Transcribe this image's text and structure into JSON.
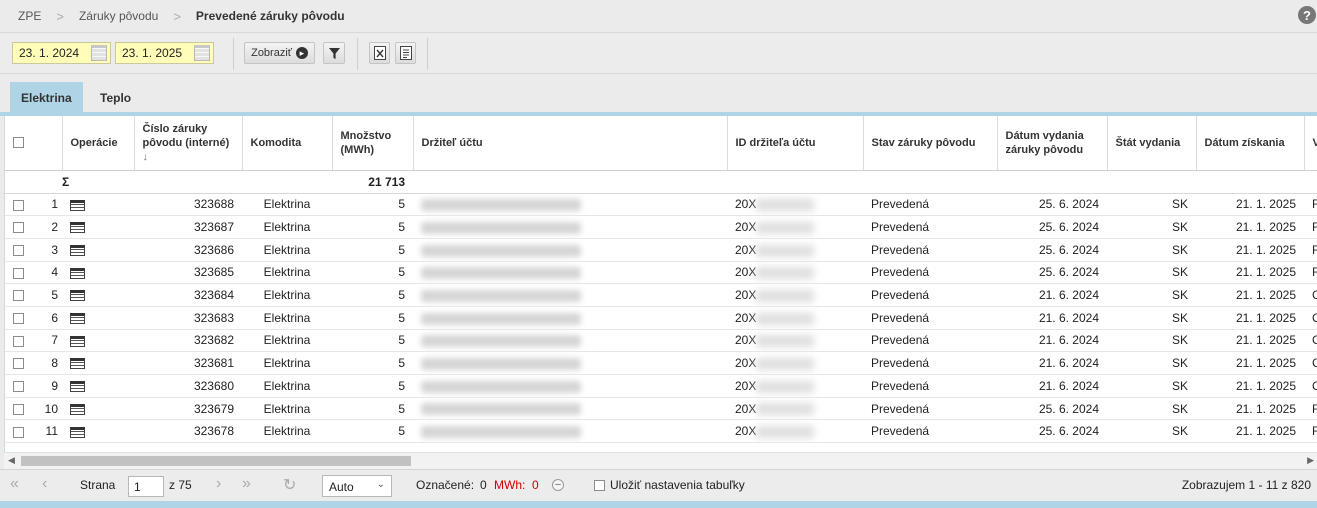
{
  "breadcrumb": {
    "items": [
      "ZPE",
      "Záruky pôvodu"
    ],
    "current": "Prevedené záruky pôvodu",
    "separator": ">"
  },
  "help_icon": "?",
  "toolbar": {
    "date_from": "23. 1. 2024",
    "date_to": "23. 1. 2025",
    "show_label": "Zobraziť",
    "icons": [
      "calendar-icon",
      "filter-icon",
      "excel-export-icon",
      "document-export-icon"
    ]
  },
  "tabs": [
    {
      "label": "Elektrina",
      "active": true
    },
    {
      "label": "Teplo",
      "active": false
    }
  ],
  "columns": {
    "operations": "Operácie",
    "number": "Číslo záruky pôvodu (interné)",
    "sort_arrow": "↓",
    "commodity": "Komodita",
    "amount": "Množstvo (MWh)",
    "holder": "Držiteľ účtu",
    "holder_id": "ID držiteľa účtu",
    "status": "Stav záruky pôvodu",
    "issue_date": "Dátum vydania záruky pôvodu",
    "country": "Štát vydania",
    "acquired_date": "Dátum získania",
    "next_partial": "V"
  },
  "summary": {
    "sigma": "Σ",
    "amount_total": "21 713"
  },
  "rows": [
    {
      "n": "1",
      "number": "323688",
      "commodity": "Elektrina",
      "amount": "5",
      "holder_id_prefix": "20X",
      "status": "Prevedená",
      "issue_date": "25. 6. 2024",
      "country": "SK",
      "acquired_date": "21. 1. 2025",
      "last": "F"
    },
    {
      "n": "2",
      "number": "323687",
      "commodity": "Elektrina",
      "amount": "5",
      "holder_id_prefix": "20X",
      "status": "Prevedená",
      "issue_date": "25. 6. 2024",
      "country": "SK",
      "acquired_date": "21. 1. 2025",
      "last": "F"
    },
    {
      "n": "3",
      "number": "323686",
      "commodity": "Elektrina",
      "amount": "5",
      "holder_id_prefix": "20X",
      "status": "Prevedená",
      "issue_date": "25. 6. 2024",
      "country": "SK",
      "acquired_date": "21. 1. 2025",
      "last": "F"
    },
    {
      "n": "4",
      "number": "323685",
      "commodity": "Elektrina",
      "amount": "5",
      "holder_id_prefix": "20X",
      "status": "Prevedená",
      "issue_date": "25. 6. 2024",
      "country": "SK",
      "acquired_date": "21. 1. 2025",
      "last": "F"
    },
    {
      "n": "5",
      "number": "323684",
      "commodity": "Elektrina",
      "amount": "5",
      "holder_id_prefix": "20X",
      "status": "Prevedená",
      "issue_date": "21. 6. 2024",
      "country": "SK",
      "acquired_date": "21. 1. 2025",
      "last": "C"
    },
    {
      "n": "6",
      "number": "323683",
      "commodity": "Elektrina",
      "amount": "5",
      "holder_id_prefix": "20X",
      "status": "Prevedená",
      "issue_date": "21. 6. 2024",
      "country": "SK",
      "acquired_date": "21. 1. 2025",
      "last": "C"
    },
    {
      "n": "7",
      "number": "323682",
      "commodity": "Elektrina",
      "amount": "5",
      "holder_id_prefix": "20X",
      "status": "Prevedená",
      "issue_date": "21. 6. 2024",
      "country": "SK",
      "acquired_date": "21. 1. 2025",
      "last": "C"
    },
    {
      "n": "8",
      "number": "323681",
      "commodity": "Elektrina",
      "amount": "5",
      "holder_id_prefix": "20X",
      "status": "Prevedená",
      "issue_date": "21. 6. 2024",
      "country": "SK",
      "acquired_date": "21. 1. 2025",
      "last": "C"
    },
    {
      "n": "9",
      "number": "323680",
      "commodity": "Elektrina",
      "amount": "5",
      "holder_id_prefix": "20X",
      "status": "Prevedená",
      "issue_date": "21. 6. 2024",
      "country": "SK",
      "acquired_date": "21. 1. 2025",
      "last": "C"
    },
    {
      "n": "10",
      "number": "323679",
      "commodity": "Elektrina",
      "amount": "5",
      "holder_id_prefix": "20X",
      "status": "Prevedená",
      "issue_date": "25. 6. 2024",
      "country": "SK",
      "acquired_date": "21. 1. 2025",
      "last": "F"
    },
    {
      "n": "11",
      "number": "323678",
      "commodity": "Elektrina",
      "amount": "5",
      "holder_id_prefix": "20X",
      "status": "Prevedená",
      "issue_date": "25. 6. 2024",
      "country": "SK",
      "acquired_date": "21. 1. 2025",
      "last": "F"
    }
  ],
  "pager": {
    "page_label": "Strana",
    "page_value": "1",
    "of_label": "z 75",
    "rows_select": "Auto",
    "selected_label": "Označené:",
    "selected_count": "0",
    "mwh_label": "MWh:",
    "mwh_value": "0",
    "save_settings_label": "Uložiť nastavenia tabuľky",
    "summary": "Zobrazujem 1 - 11 z 820"
  },
  "colors": {
    "accent_tab": "#aed4e6",
    "date_input_bg": "#fffdb8",
    "mwh_red": "#d00000"
  }
}
